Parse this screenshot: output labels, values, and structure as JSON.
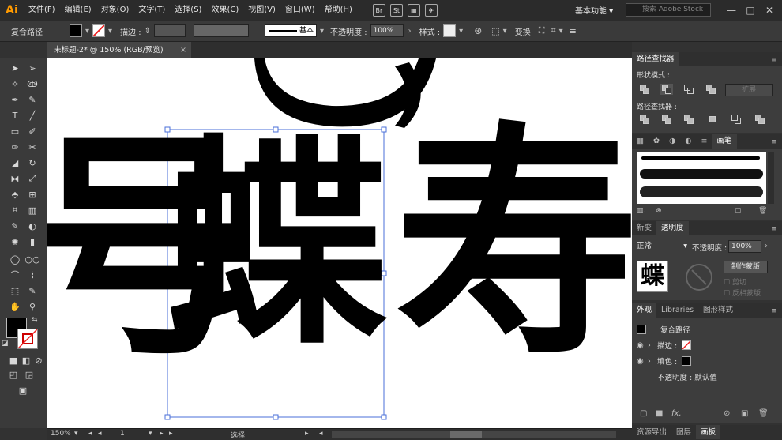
{
  "app": {
    "logo": "Ai"
  },
  "menu": [
    "文件(F)",
    "编辑(E)",
    "对象(O)",
    "文字(T)",
    "选择(S)",
    "效果(C)",
    "视图(V)",
    "窗口(W)",
    "帮助(H)"
  ],
  "menubar": {
    "workspace": "基本功能",
    "search_placeholder": "搜索 Adobe Stock",
    "bridge_label": "Br",
    "stock_label": "St"
  },
  "control": {
    "object_type": "复合路径",
    "stroke_label": "描边 :",
    "stroke_style": "基本",
    "opacity_label": "不透明度 :",
    "opacity_value": "100%",
    "style_label": "样式 :",
    "transform_label": "变换"
  },
  "document": {
    "tab_title": "未标题-2* @ 150% (RGB/预览)",
    "close": "×"
  },
  "status": {
    "zoom": "150%",
    "artboard": "1",
    "tool": "选择"
  },
  "pathfinder": {
    "title": "路径查找器",
    "shape_modes_label": "形状模式 :",
    "pathfinders_label": "路径查找器 :",
    "expand_label": "扩展"
  },
  "brushes": {
    "tabs": [
      "",
      "",
      "",
      "",
      "",
      "画笔"
    ],
    "active_tab": "画笔"
  },
  "transparency": {
    "tabs": [
      "新变",
      "透明度"
    ],
    "blend_mode": "正常",
    "opacity_label": "不透明度 :",
    "opacity_value": "100%",
    "make_mask_label": "制作蒙版",
    "clip_label": "剪切",
    "invert_label": "反相蒙版"
  },
  "appearance": {
    "tabs": [
      "外观",
      "Libraries",
      "图形样式"
    ],
    "object_label": "复合路径",
    "rows": [
      {
        "label": "描边 :"
      },
      {
        "label": "填色 :"
      }
    ],
    "opacity_row": "不透明度 : 默认值",
    "fx_label": "fx."
  },
  "bottom_tabs": [
    "资源导出",
    "图层",
    "画板"
  ],
  "artwork": {
    "glyph_a": "蝶",
    "glyph_b": "寿",
    "glyph_c": "号"
  },
  "colors": {
    "ai_orange": "#ff9a00",
    "panel_bg": "#3d3d3d",
    "selection": "#4a6fd8"
  }
}
